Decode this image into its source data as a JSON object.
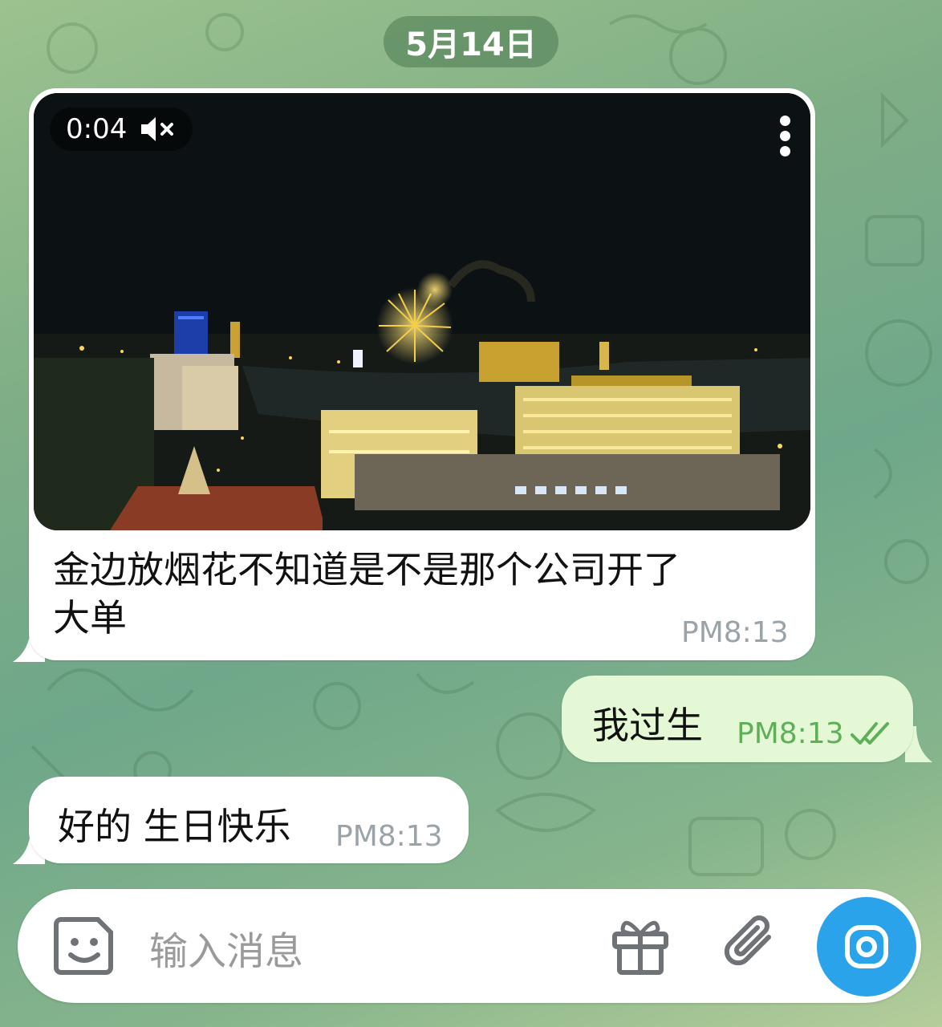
{
  "date_separator": "5月14日",
  "messages": [
    {
      "direction": "incoming",
      "type": "video",
      "video_duration": "0:04",
      "text": "金边放烟花不知道是不是那个公司开了大单",
      "text_line1": "金边放烟花不知道是不是那个公司开了",
      "text_line2": "大单",
      "time": "PM8:13"
    },
    {
      "direction": "outgoing",
      "type": "text",
      "text": "我过生",
      "time": "PM8:13",
      "status": "read"
    },
    {
      "direction": "incoming",
      "type": "text",
      "text": "好的 生日快乐",
      "time": "PM8:13"
    }
  ],
  "composer": {
    "placeholder": "输入消息",
    "icons": [
      "sticker-icon",
      "gift-icon",
      "attach-icon",
      "camera-icon"
    ]
  },
  "colors": {
    "accent": "#2aa3ea",
    "outgoing_bubble": "#e4f8d6",
    "read_check": "#5fae58"
  }
}
